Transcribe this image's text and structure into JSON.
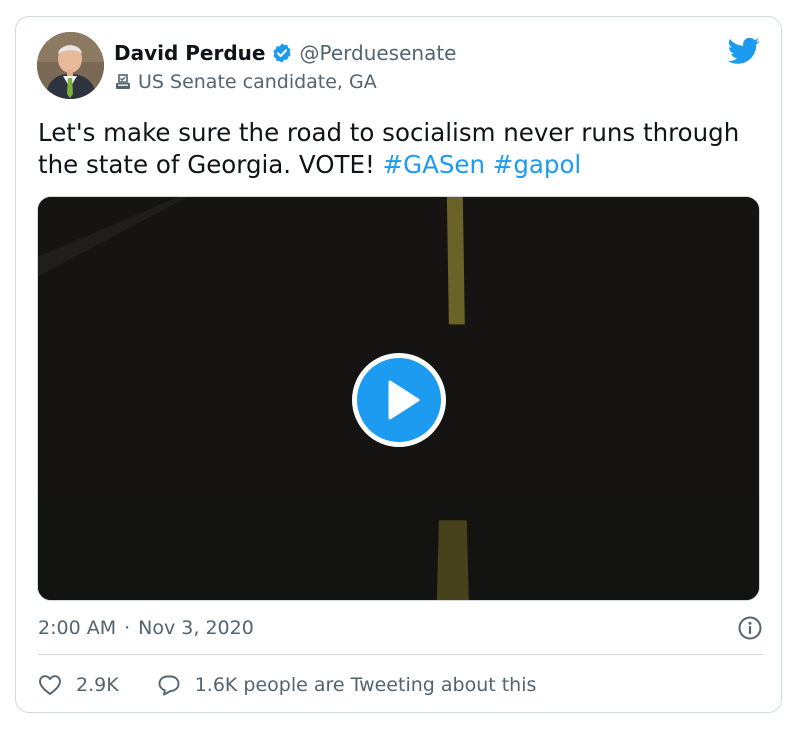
{
  "author": {
    "display_name": "David Perdue",
    "handle": "@Perduesenate",
    "label": "US Senate candidate, GA",
    "avatar_icon": "profile-photo",
    "verified_icon": "verified-badge-icon"
  },
  "tweet": {
    "text_plain": "Let's make sure the road to socialism never runs through the state of Georgia.  VOTE! ",
    "hashtags": [
      "#GASen",
      "#gapol"
    ],
    "hashtag_separator": " "
  },
  "media": {
    "type": "video",
    "play_icon": "play-icon"
  },
  "meta": {
    "time": "2:00 AM",
    "separator": "·",
    "date": "Nov 3, 2020"
  },
  "actions": {
    "likes_count": "2.9K",
    "reply_text": "1.6K people are Tweeting about this"
  },
  "colors": {
    "accent": "#1d9bf0",
    "text_primary": "#0f1419",
    "text_secondary": "#536471",
    "border": "#cfd9de",
    "video_bg": "#151413"
  }
}
